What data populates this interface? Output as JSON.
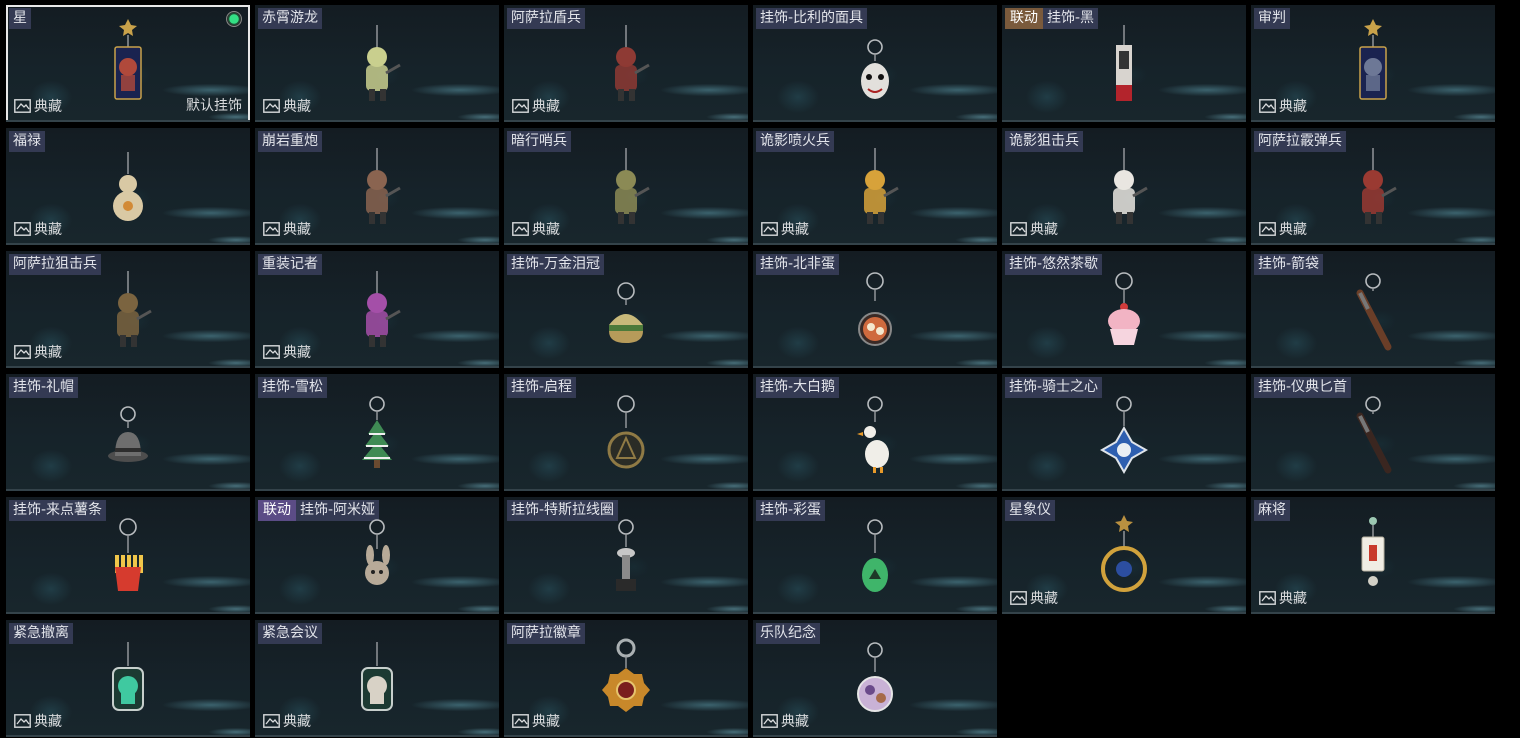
{
  "cards": [
    {
      "name": "星",
      "collection": "典藏",
      "default_label": "默认挂饰",
      "selected": true,
      "equipped": true,
      "icon": "star-tarot-card-charm-icon",
      "shape": "card",
      "color": "#b0493b"
    },
    {
      "name": "赤霄游龙",
      "collection": "典藏",
      "icon": "dragon-figure-charm-icon",
      "shape": "figure",
      "color": "#c9cf8e"
    },
    {
      "name": "阿萨拉盾兵",
      "collection": "典藏",
      "icon": "shield-soldier-charm-icon",
      "shape": "figure",
      "color": "#8e3a34"
    },
    {
      "name": "挂饰-比利的面具",
      "icon": "billy-mask-charm-icon",
      "shape": "mask",
      "color": "#e2e0dc"
    },
    {
      "name": "挂饰-黑",
      "badge": "联动",
      "badge_color": "brown",
      "icon": "black-tag-charm-icon",
      "shape": "tag",
      "color": "#d8d4cf"
    },
    {
      "name": "审判",
      "collection": "典藏",
      "icon": "judgement-tarot-card-charm-icon",
      "shape": "card",
      "color": "#6d7896"
    },
    {
      "name": "福禄",
      "collection": "典藏",
      "icon": "gourd-charm-icon",
      "shape": "gourd",
      "color": "#d9c9a4"
    },
    {
      "name": "崩岩重炮",
      "collection": "典藏",
      "icon": "heavy-gunner-charm-icon",
      "shape": "figure",
      "color": "#8a6450"
    },
    {
      "name": "暗行哨兵",
      "collection": "典藏",
      "icon": "scout-charm-icon",
      "shape": "figure",
      "color": "#8b8a55"
    },
    {
      "name": "诡影喷火兵",
      "collection": "典藏",
      "icon": "flamethrower-charm-icon",
      "shape": "figure",
      "color": "#d7a23a"
    },
    {
      "name": "诡影狙击兵",
      "collection": "典藏",
      "icon": "ghost-sniper-charm-icon",
      "shape": "figure",
      "color": "#e9e6e1"
    },
    {
      "name": "阿萨拉霰弹兵",
      "collection": "典藏",
      "icon": "shotgunner-charm-icon",
      "shape": "figure",
      "color": "#9a3a32"
    },
    {
      "name": "阿萨拉狙击兵",
      "collection": "典藏",
      "icon": "asala-sniper-charm-icon",
      "shape": "figure",
      "color": "#7b6440"
    },
    {
      "name": "重装记者",
      "collection": "典藏",
      "icon": "reporter-charm-icon",
      "shape": "figure",
      "color": "#a44fa8"
    },
    {
      "name": "挂饰-万金泪冠",
      "icon": "burger-charm-icon",
      "shape": "burger",
      "color": "#c8b97a"
    },
    {
      "name": "挂饰-北非蛋",
      "icon": "shakshuka-charm-icon",
      "shape": "pan",
      "color": "#cf6a3e"
    },
    {
      "name": "挂饰-悠然茶歇",
      "icon": "cupcake-charm-icon",
      "shape": "cupcake",
      "color": "#f2b4c4"
    },
    {
      "name": "挂饰-箭袋",
      "icon": "quiver-charm-icon",
      "shape": "stick",
      "color": "#6a3e28"
    },
    {
      "name": "挂饰-礼帽",
      "icon": "hat-charm-icon",
      "shape": "hat",
      "color": "#6e6e6e"
    },
    {
      "name": "挂饰-雪松",
      "icon": "pine-tree-charm-icon",
      "shape": "tree",
      "color": "#3f8b54"
    },
    {
      "name": "挂饰-启程",
      "icon": "compass-medal-charm-icon",
      "shape": "medal",
      "color": "#8f7a45"
    },
    {
      "name": "挂饰-大白鹅",
      "icon": "goose-charm-icon",
      "shape": "goose",
      "color": "#f0eee8"
    },
    {
      "name": "挂饰-骑士之心",
      "icon": "knight-cross-charm-icon",
      "shape": "cross",
      "color": "#2e5fb0"
    },
    {
      "name": "挂饰-仪典匕首",
      "icon": "dagger-charm-icon",
      "shape": "stick",
      "color": "#3a2620"
    },
    {
      "name": "挂饰-来点薯条",
      "icon": "fries-charm-icon",
      "shape": "fries",
      "color": "#d63b2e"
    },
    {
      "name": "挂饰-阿米娅",
      "badge": "联动",
      "badge_color": "purple",
      "icon": "amiya-bunny-charm-icon",
      "shape": "bunny",
      "color": "#b7aa98"
    },
    {
      "name": "挂饰-特斯拉线圈",
      "icon": "tesla-coil-charm-icon",
      "shape": "coil",
      "color": "#c7c7c7"
    },
    {
      "name": "挂饰-彩蛋",
      "icon": "easter-egg-charm-icon",
      "shape": "egg",
      "color": "#3fb56a"
    },
    {
      "name": "星象仪",
      "collection": "典藏",
      "icon": "astrolabe-charm-icon",
      "shape": "astrolabe",
      "color": "#d1a23c"
    },
    {
      "name": "麻将",
      "collection": "典藏",
      "icon": "mahjong-tile-charm-icon",
      "shape": "mahjong",
      "color": "#f0ede4"
    },
    {
      "name": "紧急撤离",
      "collection": "典藏",
      "icon": "evac-acrylic-charm-icon",
      "shape": "acrylic",
      "color": "#3fc9a0"
    },
    {
      "name": "紧急会议",
      "collection": "典藏",
      "icon": "meeting-acrylic-charm-icon",
      "shape": "acrylic",
      "color": "#d8d2c6"
    },
    {
      "name": "阿萨拉徽章",
      "collection": "典藏",
      "icon": "asala-badge-charm-icon",
      "shape": "badge",
      "color": "#c8882a"
    },
    {
      "name": "乐队纪念",
      "collection": "典藏",
      "icon": "band-badge-charm-icon",
      "shape": "round",
      "color": "#c9b2d6"
    }
  ]
}
